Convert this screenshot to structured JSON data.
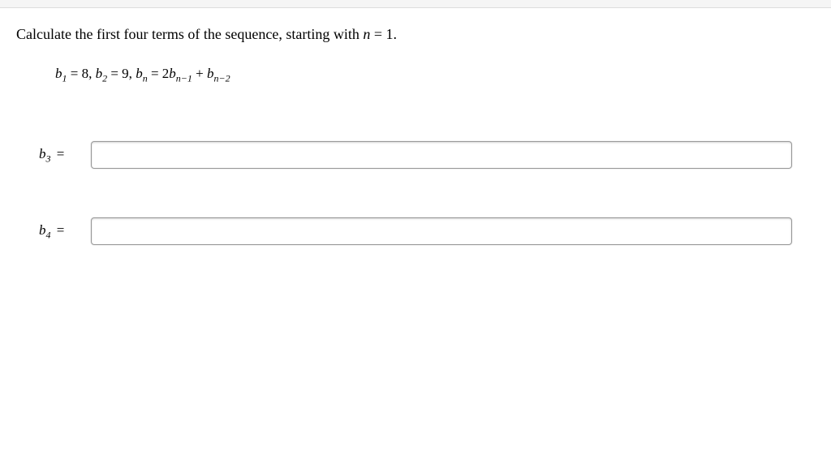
{
  "instruction": {
    "prefix": "Calculate the first four terms of the sequence, starting with ",
    "var": "n",
    "suffix": " = 1."
  },
  "formula": {
    "b1_label": "b",
    "b1_sub": "1",
    "b1_value": " = 8, ",
    "b2_label": "b",
    "b2_sub": "2",
    "b2_value": " = 9, ",
    "bn_label": "b",
    "bn_sub": "n",
    "bn_eq": " = 2",
    "bn1_label": "b",
    "bn1_sub": "n−1",
    "plus": " + ",
    "bn2_label": "b",
    "bn2_sub": "n−2"
  },
  "answers": {
    "b3": {
      "label": "b",
      "sub": "3",
      "eq": " =",
      "value": ""
    },
    "b4": {
      "label": "b",
      "sub": "4",
      "eq": " =",
      "value": ""
    }
  }
}
